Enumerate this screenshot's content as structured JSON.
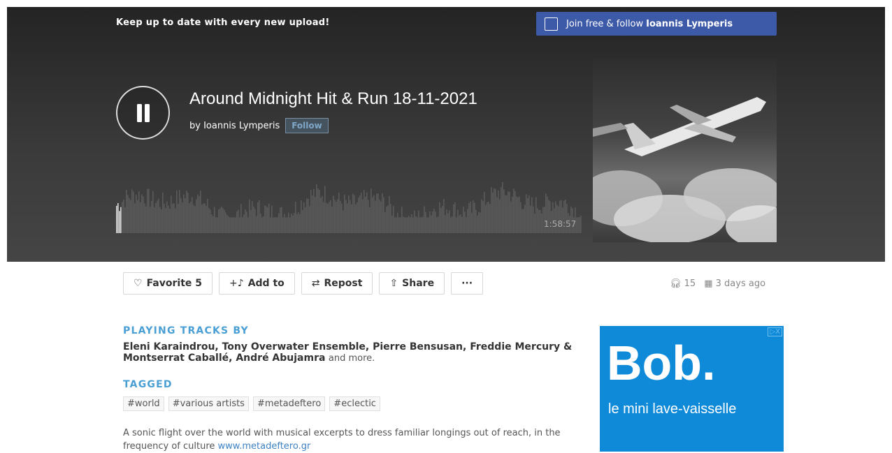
{
  "promo": {
    "text": "Keep up to date with every new upload!",
    "join_prefix": "Join free & follow",
    "join_name": "Ioannis Lymperis"
  },
  "player": {
    "state": "playing",
    "title": "Around Midnight Hit & Run 18-11-2021",
    "by_label": "by Ioannis Lymperis",
    "follow_label": "Follow",
    "duration": "1:58:57",
    "cover_icon": "airplane-cover-art"
  },
  "actions": {
    "favorite_label": "Favorite 5",
    "add_to_label": "Add to",
    "repost_label": "Repost",
    "share_label": "Share",
    "more_label": "···"
  },
  "stats": {
    "plays": "15",
    "posted": "3 days ago"
  },
  "playing_tracks": {
    "heading": "PLAYING TRACKS BY",
    "artists": "Eleni Karaindrou, Tony Overwater Ensemble, Pierre Bensusan, Freddie Mercury & Montserrat Caballé, André Abujamra",
    "more": "and more."
  },
  "tagged": {
    "heading": "TAGGED",
    "tags": [
      "#world",
      "#various artists",
      "#metadeftero",
      "#eclectic"
    ]
  },
  "description": {
    "text": "A sonic flight over the world with musical excerpts to dress familiar longings out of reach, in the frequency of culture",
    "link": "www.metadeftero.gr"
  },
  "ad": {
    "brand": "Bob.",
    "tagline": "le mini lave-vaisselle"
  },
  "colors": {
    "accent": "#4a9fd4",
    "join_button": "#3d5aa9",
    "ad_background": "#0e8ad8"
  }
}
